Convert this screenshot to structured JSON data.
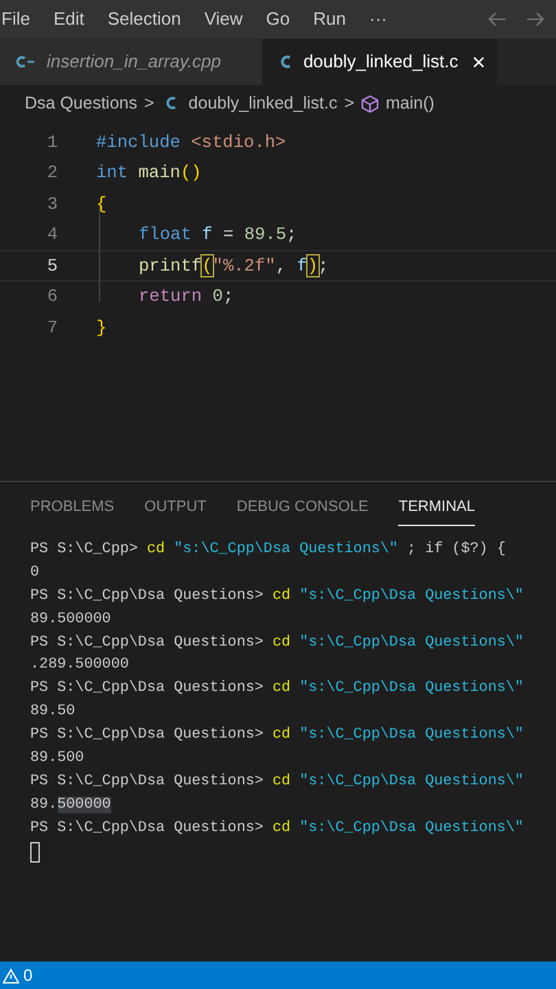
{
  "menu_bar": {
    "items": [
      "File",
      "Edit",
      "Selection",
      "View",
      "Go",
      "Run",
      "···"
    ]
  },
  "tabs": [
    {
      "label": "insertion_in_array.cpp",
      "kind": "cpp",
      "selected": false
    },
    {
      "label": "doubly_linked_list.c",
      "kind": "c",
      "selected": true,
      "close": "×"
    }
  ],
  "breadcrumb": {
    "folder": "Dsa Questions",
    "separator": ">",
    "file": "doubly_linked_list.c",
    "symbol": "main()"
  },
  "editor": {
    "lines": [
      {
        "number": "1",
        "current": false,
        "tokens": [
          {
            "kind": "keyword",
            "text": "#include "
          },
          {
            "kind": "string",
            "text": "<stdio.h>"
          }
        ]
      },
      {
        "number": "2",
        "current": false,
        "tokens": [
          {
            "kind": "keyword",
            "text": "int "
          },
          {
            "kind": "func",
            "text": "main"
          },
          {
            "kind": "brace",
            "text": "()"
          }
        ]
      },
      {
        "number": "3",
        "current": false,
        "tokens": [
          {
            "kind": "brace",
            "text": "{"
          }
        ]
      },
      {
        "number": "4",
        "current": false,
        "indented": true,
        "tokens": [
          {
            "kind": "keyword",
            "text": "float "
          },
          {
            "kind": "variable",
            "text": "f"
          },
          {
            "kind": "plain",
            "text": " = "
          },
          {
            "kind": "number",
            "text": "89.5"
          },
          {
            "kind": "plain",
            "text": ";"
          }
        ]
      },
      {
        "number": "5",
        "current": true,
        "indented": true,
        "tokens": [
          {
            "kind": "func",
            "text": "printf"
          },
          {
            "kind": "match",
            "text": "("
          },
          {
            "kind": "string",
            "text": "\"%.2f\""
          },
          {
            "kind": "plain",
            "text": ", "
          },
          {
            "kind": "variable",
            "text": "f"
          },
          {
            "kind": "match",
            "text": ")"
          },
          {
            "kind": "plain",
            "text": ";"
          }
        ]
      },
      {
        "number": "6",
        "current": false,
        "indented": true,
        "tokens": [
          {
            "kind": "control",
            "text": "return "
          },
          {
            "kind": "number",
            "text": "0"
          },
          {
            "kind": "plain",
            "text": ";"
          }
        ]
      },
      {
        "number": "7",
        "current": false,
        "tokens": [
          {
            "kind": "brace",
            "text": "}"
          }
        ]
      }
    ]
  },
  "panel": {
    "tabs": [
      {
        "label": "PROBLEMS",
        "selected": false
      },
      {
        "label": "OUTPUT",
        "selected": false
      },
      {
        "label": "DEBUG CONSOLE",
        "selected": false
      },
      {
        "label": "TERMINAL",
        "selected": true
      }
    ]
  },
  "terminal": {
    "lines": [
      {
        "kind": "command",
        "prompt": "PS S:\\C_Cpp> ",
        "command": "cd",
        "argument": " \"s:\\C_Cpp\\Dsa Questions\\\"",
        "rest": " ; if ($?) {"
      },
      {
        "kind": "output",
        "text": "0"
      },
      {
        "kind": "command",
        "prompt": "PS S:\\C_Cpp\\Dsa Questions> ",
        "command": "cd",
        "argument": " \"s:\\C_Cpp\\Dsa Questions\\\""
      },
      {
        "kind": "output",
        "text": "89.500000"
      },
      {
        "kind": "command",
        "prompt": "PS S:\\C_Cpp\\Dsa Questions> ",
        "command": "cd",
        "argument": " \"s:\\C_Cpp\\Dsa Questions\\\""
      },
      {
        "kind": "output",
        "text": ".289.500000"
      },
      {
        "kind": "command",
        "prompt": "PS S:\\C_Cpp\\Dsa Questions> ",
        "command": "cd",
        "argument": " \"s:\\C_Cpp\\Dsa Questions\\\""
      },
      {
        "kind": "output",
        "text": "89.50"
      },
      {
        "kind": "command",
        "prompt": "PS S:\\C_Cpp\\Dsa Questions> ",
        "command": "cd",
        "argument": " \"s:\\C_Cpp\\Dsa Questions\\\""
      },
      {
        "kind": "output",
        "text": "89.500"
      },
      {
        "kind": "command",
        "prompt": "PS S:\\C_Cpp\\Dsa Questions> ",
        "command": "cd",
        "argument": " \"s:\\C_Cpp\\Dsa Questions\\\""
      },
      {
        "kind": "output",
        "text": "89.",
        "selected_text": "500000"
      },
      {
        "kind": "command",
        "prompt": "PS S:\\C_Cpp\\Dsa Questions> ",
        "command": "cd",
        "argument": " \"s:\\C_Cpp\\Dsa Questions\\\""
      },
      {
        "kind": "cursor"
      }
    ]
  },
  "status_bar": {
    "warnings": "0"
  }
}
